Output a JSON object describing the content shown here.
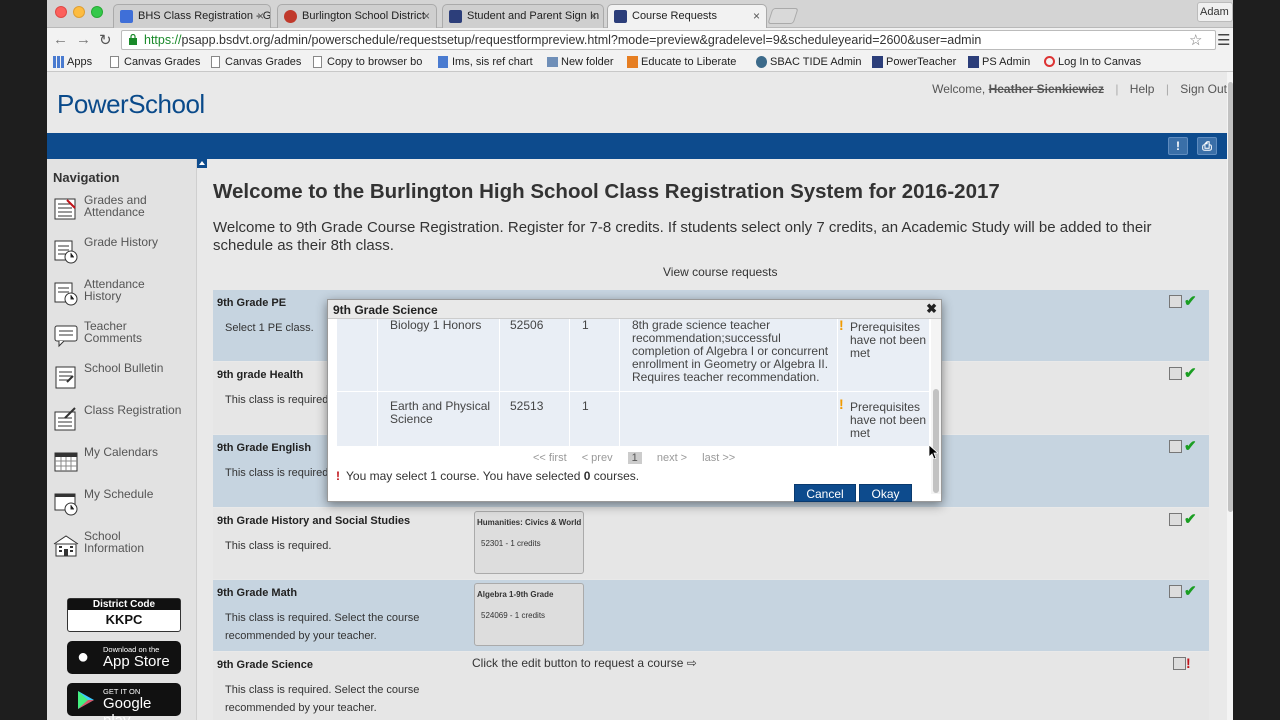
{
  "browser": {
    "tabs": [
      {
        "label": "BHS Class Registration - G",
        "icon_color": "#3f6fd8",
        "active": false
      },
      {
        "label": "Burlington School District",
        "icon_color": "#c0392b",
        "active": false
      },
      {
        "label": "Student and Parent Sign In",
        "icon_color": "#2c3e7a",
        "active": false
      },
      {
        "label": "Course Requests",
        "icon_color": "#2c3e7a",
        "active": true
      }
    ],
    "user_chip": "Adam",
    "url_scheme": "https://",
    "url_rest": "psapp.bsdvt.org/admin/powerschedule/requestsetup/requestformpreview.html?mode=preview&gradelevel=9&scheduleyearid=2600&user=admin",
    "bookmarks": [
      {
        "label": "Apps",
        "icon": "apps-grid-icon"
      },
      {
        "label": "Canvas Grades",
        "icon": "page-icon"
      },
      {
        "label": "Canvas Grades",
        "icon": "page-icon"
      },
      {
        "label": "Copy to browser bo",
        "icon": "page-icon"
      },
      {
        "label": "Ims, sis ref chart",
        "icon": "doc-icon"
      },
      {
        "label": "New folder",
        "icon": "folder-icon"
      },
      {
        "label": "Educate to Liberate",
        "icon": "edu-icon"
      },
      {
        "label": "SBAC TIDE Admin",
        "icon": "globe-icon"
      },
      {
        "label": "PowerTeacher",
        "icon": "p-icon"
      },
      {
        "label": "PS Admin",
        "icon": "p-icon"
      },
      {
        "label": "Log In to Canvas",
        "icon": "canvas-icon"
      }
    ]
  },
  "header": {
    "logo": "PowerSchool",
    "welcome": "Welcome,",
    "user_name": "Heather Sienkiewicz",
    "help": "Help",
    "sign_out": "Sign Out"
  },
  "sidebar": {
    "title": "Navigation",
    "items": [
      {
        "label": "Grades and Attendance",
        "icon": "grades-attendance-icon"
      },
      {
        "label": "Grade History",
        "icon": "grade-history-icon"
      },
      {
        "label": "Attendance History",
        "icon": "attendance-history-icon"
      },
      {
        "label": "Teacher Comments",
        "icon": "teacher-comments-icon"
      },
      {
        "label": "School Bulletin",
        "icon": "school-bulletin-icon"
      },
      {
        "label": "Class Registration",
        "icon": "class-registration-icon"
      },
      {
        "label": "My Calendars",
        "icon": "calendar-icon"
      },
      {
        "label": "My Schedule",
        "icon": "schedule-icon"
      },
      {
        "label": "School Information",
        "icon": "school-icon"
      }
    ],
    "district_code_label": "District Code",
    "district_code": "KKPC",
    "app_store_small": "Download on the",
    "app_store": "App Store",
    "google_play_small": "GET IT ON",
    "google_play": "Google play"
  },
  "main": {
    "title": "Welcome to the Burlington High School Class Registration System for 2016-2017",
    "intro": "Welcome to 9th Grade Course Registration. Register for 7-8 credits. If students select only 7 credits, an Academic Study will be added to their schedule as their 8th class.",
    "view_requests": "View course requests",
    "requests": [
      {
        "name": "9th Grade PE",
        "desc": "Select 1 PE class.",
        "card_title": "",
        "card_sub": "",
        "status": "complete"
      },
      {
        "name": "9th grade Health",
        "desc": "This class is required.",
        "card_title": "",
        "card_sub": "",
        "status": "complete"
      },
      {
        "name": "9th Grade English",
        "desc": "This class is required.",
        "card_title": "",
        "card_sub": "",
        "status": "complete"
      },
      {
        "name": "9th Grade History and Social Studies",
        "desc": "This class is required.",
        "card_title": "Humanities: Civics & World",
        "card_sub": "52301 - 1 credits",
        "status": "complete"
      },
      {
        "name": "9th Grade Math",
        "desc": "This class is required. Select the course recommended by your teacher.",
        "card_title": "Algebra 1-9th Grade",
        "card_sub": "524069 - 1 credits",
        "status": "complete"
      },
      {
        "name": "9th Grade Science",
        "desc": "This class is required. Select the course recommended by your teacher.",
        "card_title": "",
        "card_sub": "",
        "status": "incomplete"
      }
    ],
    "click_edit_text": "Click the edit button to request a course ⇨"
  },
  "modal": {
    "title": "9th Grade Science",
    "rows": [
      {
        "course": "Biology 1 Honors",
        "number": "52506",
        "credits": "1",
        "prereq": "8th grade science teacher recommendation;successful completion of Algebra I or concurrent enrollment in Geometry or Algebra II. Requires teacher recommendation.",
        "status": "Prerequisites have not been met"
      },
      {
        "course": "Earth and Physical Science",
        "number": "52513",
        "credits": "1",
        "prereq": "",
        "status": "Prerequisites have not been met"
      }
    ],
    "pager": {
      "first": "<< first",
      "prev": "< prev",
      "current": "1",
      "next": "next >",
      "last": "last >>"
    },
    "message_pre": "You may select 1 course. You have selected ",
    "message_count": "0",
    "message_post": " courses.",
    "cancel": "Cancel",
    "okay": "Okay"
  }
}
